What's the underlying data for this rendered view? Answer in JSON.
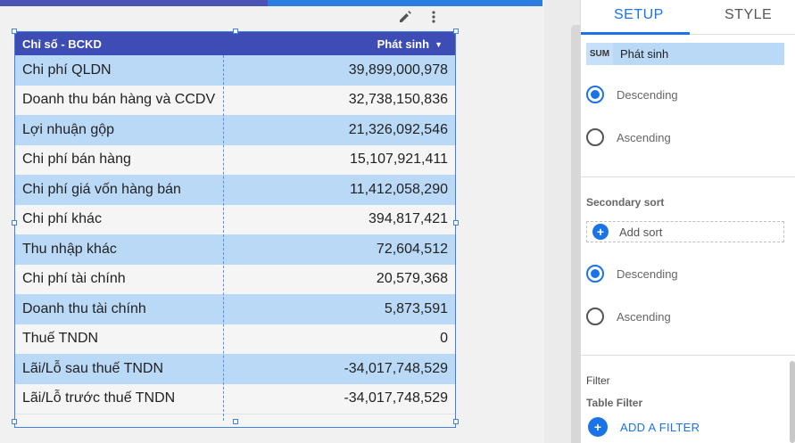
{
  "table": {
    "header_dimension": "Chỉ số - BCKD",
    "header_metric": "Phát sinh",
    "sort_arrow": "▼",
    "rows": [
      {
        "label": "Chi phí QLDN",
        "value": "39,899,000,978"
      },
      {
        "label": "Doanh thu bán hàng và CCDV",
        "value": "32,738,150,836"
      },
      {
        "label": "Lợi nhuận gộp",
        "value": "21,326,092,546"
      },
      {
        "label": "Chi phí bán hàng",
        "value": "15,107,921,411"
      },
      {
        "label": "Chi phí giá vốn hàng bán",
        "value": "11,412,058,290"
      },
      {
        "label": "Chi phí khác",
        "value": "394,817,421"
      },
      {
        "label": "Thu nhập khác",
        "value": "72,604,512"
      },
      {
        "label": "Chi phí tài chính",
        "value": "20,579,368"
      },
      {
        "label": "Doanh thu tài chính",
        "value": "5,873,591"
      },
      {
        "label": "Thuế TNDN",
        "value": "0"
      },
      {
        "label": "Lãi/Lỗ sau thuế TNDN",
        "value": "-34,017,748,529"
      },
      {
        "label": "Lãi/Lỗ trước thuế TNDN",
        "value": "-34,017,748,529"
      }
    ]
  },
  "toolbar": {
    "edit_icon": "pencil-icon",
    "more_icon": "more-vert-icon"
  },
  "panel": {
    "tabs": {
      "setup": "SETUP",
      "style": "STYLE"
    },
    "sort_metric": {
      "badge": "SUM",
      "label": "Phát sinh"
    },
    "sort_order": {
      "descending": "Descending",
      "ascending": "Ascending",
      "selected": "descending"
    },
    "secondary_sort": {
      "title": "Secondary sort",
      "add_label": "Add sort",
      "descending": "Descending",
      "ascending": "Ascending",
      "selected": "descending"
    },
    "filter": {
      "title": "Filter",
      "table_filter": "Table Filter",
      "add_label": "ADD A FILTER"
    }
  },
  "colors": {
    "header_bg": "#3d4db5",
    "row_highlight": "#bad9f7",
    "accent": "#1a73e8"
  }
}
